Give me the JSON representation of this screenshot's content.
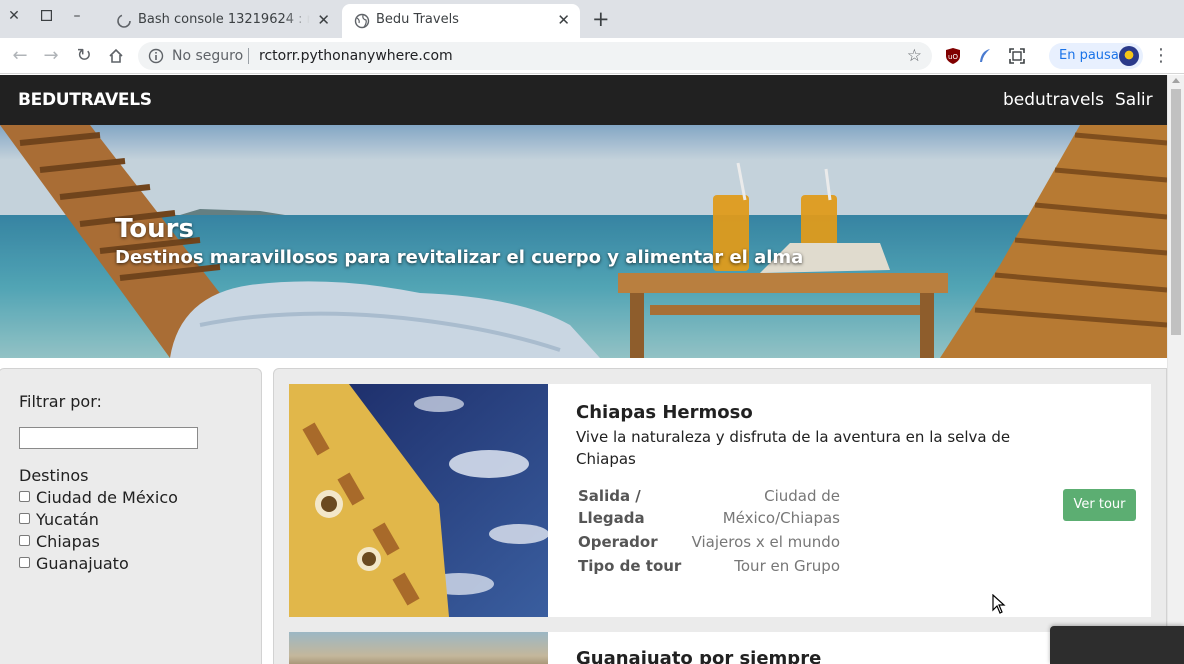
{
  "browser": {
    "tabs": [
      {
        "title": "Bash console 13219624 : rctorr",
        "active": false
      },
      {
        "title": "Bedu Travels",
        "active": true
      }
    ],
    "omnibox": {
      "security_status": "No seguro",
      "url": "rctorr.pythonanywhere.com"
    },
    "profile": {
      "status": "En pausa"
    }
  },
  "navbar": {
    "brand": "BEDUTRAVELS",
    "links": [
      "bedutravels",
      "Salir"
    ]
  },
  "hero": {
    "title": "Tours",
    "subtitle": "Destinos maravillosos para revitalizar el cuerpo y alimentar el alma"
  },
  "filter": {
    "label": "Filtrar por:",
    "search_value": "",
    "destinations_heading": "Destinos",
    "destinations": [
      "Ciudad de México",
      "Yucatán",
      "Chiapas",
      "Guanajuato"
    ]
  },
  "tours": [
    {
      "name": "Chiapas Hermoso",
      "description": "Vive la naturaleza y disfruta de la aventura en la selva de Chiapas",
      "details": [
        {
          "key": "Salida / Llegada",
          "value": "Ciudad de México/Chiapas"
        },
        {
          "key": "Operador",
          "value": "Viajeros x el mundo"
        },
        {
          "key": "Tipo de tour",
          "value": "Tour en Grupo"
        }
      ],
      "button": "Ver tour"
    },
    {
      "name": "Guanajuato por siempre"
    }
  ],
  "colors": {
    "navbar_bg": "#212121",
    "button_green": "#5cae72",
    "panel_bg": "#ebebeb"
  }
}
